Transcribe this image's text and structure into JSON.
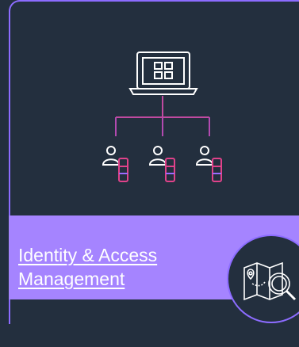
{
  "card": {
    "title_line1": "Identity & Access",
    "title_line2": "Management"
  },
  "colors": {
    "background": "#232f3e",
    "accent": "#a584ff",
    "border": "#8c6cff",
    "line_white": "#ffffff",
    "user_stroke_magenta": "#e0428a",
    "user_stroke_purple": "#9b6bff"
  },
  "icons": {
    "laptop": "laptop-icon",
    "users": [
      "user-device-icon",
      "user-device-icon",
      "user-device-icon"
    ],
    "badge": "map-search-icon"
  }
}
